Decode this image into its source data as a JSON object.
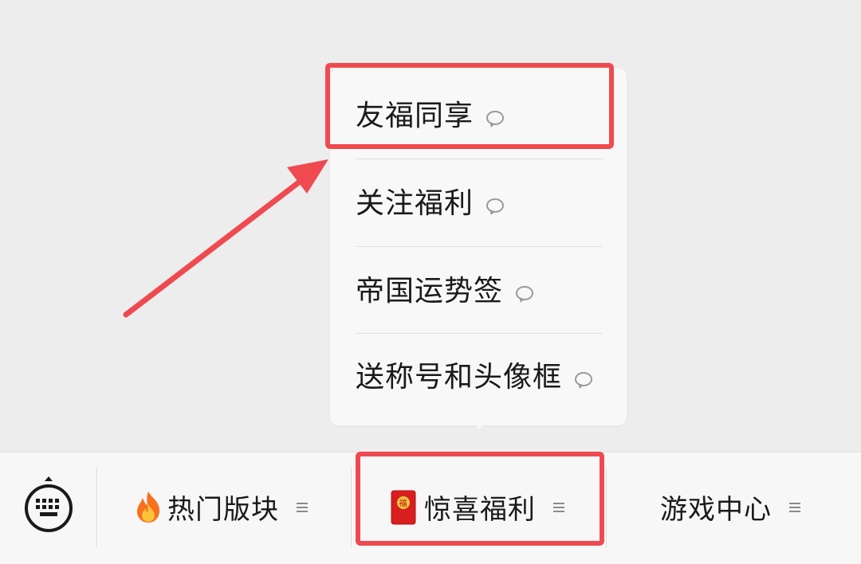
{
  "menu": {
    "items": [
      {
        "label": "友福同享",
        "icon": "comment-bubble-icon"
      },
      {
        "label": "关注福利",
        "icon": "comment-bubble-icon"
      },
      {
        "label": "帝国运势签",
        "icon": "comment-bubble-icon"
      },
      {
        "label": "送称号和头像框",
        "icon": "comment-bubble-icon"
      }
    ]
  },
  "bottom_bar": {
    "keyboard_icon": "keyboard-icon",
    "tabs": [
      {
        "label": "热门版块",
        "icon": "fire-icon",
        "menu_icon": "hamburger-icon"
      },
      {
        "label": "惊喜福利",
        "icon": "red-envelope-icon",
        "menu_icon": "hamburger-icon"
      },
      {
        "label": "游戏中心",
        "menu_icon": "hamburger-icon"
      }
    ]
  },
  "envelope_glyph": "福",
  "colors": {
    "highlight": "#ef4a4f",
    "background": "#ededed",
    "popup": "#f8f8f8",
    "bar": "#f7f7f7"
  }
}
